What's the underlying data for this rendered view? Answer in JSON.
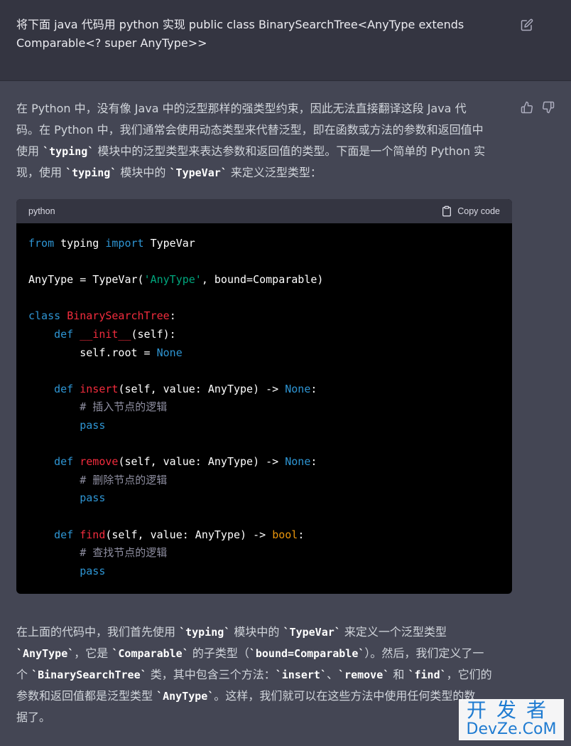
{
  "user_message": {
    "line1": "将下面 java 代码用 python 实现 public class BinarySearchTree<AnyType extends",
    "line2": "Comparable<? super AnyType>>",
    "edit_icon": "edit-icon"
  },
  "assistant": {
    "intro": {
      "l1": "在 Python 中，没有像 Java 中的泛型那样的强类型约束，因此无法直接翻译这段 Java 代",
      "l2": "码。在 Python 中，我们通常会使用动态类型来代替泛型，即在函数或方法的参数和返回值中",
      "l3a": "使用 ",
      "l3code": "`typing`",
      "l3b": " 模块中的泛型类型来表达参数和返回值的类型。下面是一个简单的 Python 实",
      "l4a": "现，使用 ",
      "l4code1": "`typing`",
      "l4b": " 模块中的 ",
      "l4code2": "`TypeVar`",
      "l4c": " 来定义泛型类型："
    },
    "thumb_up_icon": "thumbs-up-icon",
    "thumb_down_icon": "thumbs-down-icon",
    "code_block": {
      "language": "python",
      "copy_label": "Copy code",
      "lines": [
        "from typing import TypeVar",
        "",
        "AnyType = TypeVar('AnyType', bound=Comparable)",
        "",
        "class BinarySearchTree:",
        "    def __init__(self):",
        "        self.root = None",
        "",
        "    def insert(self, value: AnyType) -> None:",
        "        # 插入节点的逻辑",
        "        pass",
        "",
        "    def remove(self, value: AnyType) -> None:",
        "        # 删除节点的逻辑",
        "        pass",
        "",
        "    def find(self, value: AnyType) -> bool:",
        "        # 查找节点的逻辑",
        "        pass"
      ]
    },
    "outro": {
      "l1a": "在上面的代码中，我们首先使用 ",
      "l1c1": "`typing`",
      "l1b": " 模块中的 ",
      "l1c2": "`TypeVar`",
      "l1d": " 来定义一个泛型类型",
      "l2c1": "`AnyType`",
      "l2a": "，它是 ",
      "l2c2": "`Comparable`",
      "l2b": " 的子类型（",
      "l2c3": "`bound=Comparable`",
      "l2d": "）。然后，我们定义了一",
      "l3a": "个 ",
      "l3c1": "`BinarySearchTree`",
      "l3b": " 类，其中包含三个方法：",
      "l3c2": "`insert`",
      "l3s1": "、",
      "l3c3": "`remove`",
      "l3s2": " 和 ",
      "l3c4": "`find`",
      "l3d": "，它们的",
      "l4a": "参数和返回值都是泛型类型 ",
      "l4c1": "`AnyType`",
      "l4b": "。这样，我们就可以在这些方法中使用任何类型的数",
      "l5": "据了。"
    }
  },
  "watermark": {
    "top": "开发者",
    "bottom": "DevZe.CoM"
  }
}
